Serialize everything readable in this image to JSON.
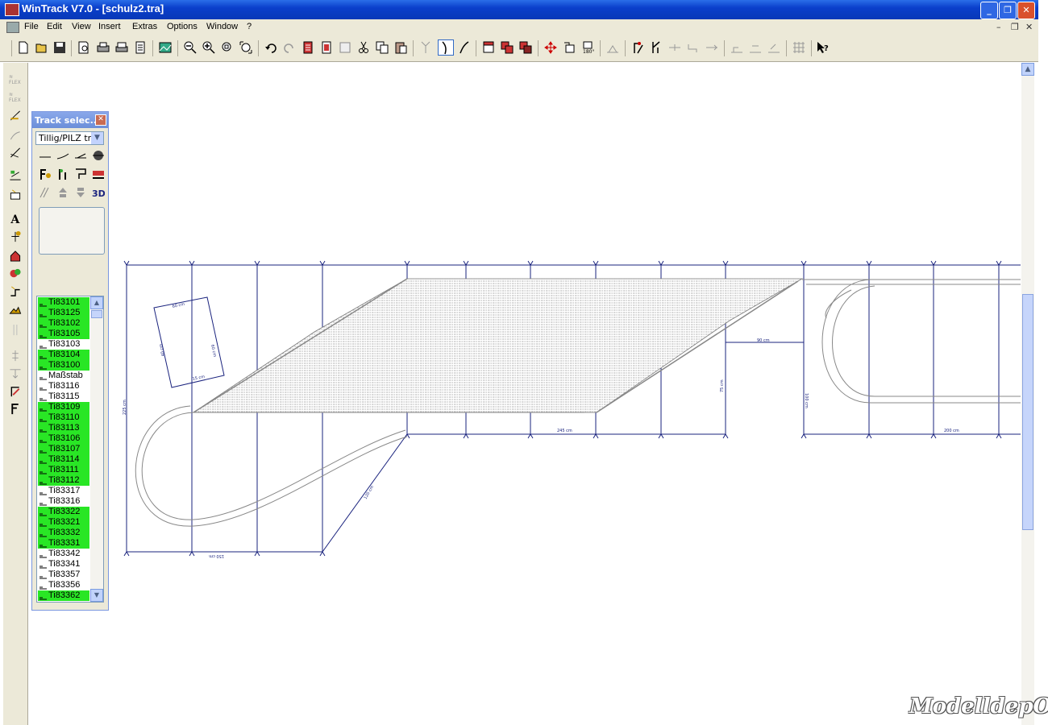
{
  "window": {
    "title": "WinTrack  V7.0 - [schulz2.tra]"
  },
  "menubar": {
    "items": [
      "File",
      "Edit",
      "View",
      "Insert",
      "Extras",
      "Options",
      "Window",
      "?"
    ]
  },
  "toolbar": {
    "icons": [
      "new-icon",
      "open-icon",
      "save-icon",
      "print-preview-icon",
      "print-icon",
      "print-setup-icon",
      "page-icon",
      "landscape-icon",
      "zoom-out-icon",
      "zoom-in-icon",
      "zoom-window-icon",
      "zoom-fit-icon",
      "undo-icon",
      "redo-icon",
      "parts-list-icon",
      "report-icon",
      "table-icon",
      "cut-icon",
      "copy-icon",
      "paste-icon",
      "switch-icon",
      "curve-icon",
      "flex-icon",
      "layer-icon",
      "layer-copy-icon",
      "layer-move-icon",
      "move-icon",
      "rotate-icon",
      "rotate-180-icon",
      "height-icon",
      "signal-icon",
      "turnout-icon",
      "line-icon",
      "connect-icon",
      "join-icon",
      "ramp-icon",
      "ramp2-icon",
      "ramp3-icon",
      "grid-icon",
      "help-icon"
    ]
  },
  "lefttoolbar": {
    "flex1": "FLEX",
    "flex2": "FLEX",
    "text_tool": "A"
  },
  "track_panel": {
    "title": "Track selec...",
    "manufacturer": "Tillig/PILZ tra",
    "label_3d": "3D",
    "items": [
      {
        "label": "Ti83101",
        "highlighted": true
      },
      {
        "label": "Ti83125",
        "highlighted": true
      },
      {
        "label": "Ti83102",
        "highlighted": true
      },
      {
        "label": "Ti83105",
        "highlighted": true
      },
      {
        "label": "Ti83103",
        "highlighted": false
      },
      {
        "label": "Ti83104",
        "highlighted": true
      },
      {
        "label": "Ti83100",
        "highlighted": true
      },
      {
        "label": "Maßstab",
        "highlighted": false
      },
      {
        "label": "Ti83116",
        "highlighted": false
      },
      {
        "label": "Ti83115",
        "highlighted": false
      },
      {
        "label": "Ti83109",
        "highlighted": true
      },
      {
        "label": "Ti83110",
        "highlighted": true
      },
      {
        "label": "Ti83113",
        "highlighted": true
      },
      {
        "label": "Ti83106",
        "highlighted": true
      },
      {
        "label": "Ti83107",
        "highlighted": true
      },
      {
        "label": "Ti83114",
        "highlighted": true
      },
      {
        "label": "Ti83111",
        "highlighted": true
      },
      {
        "label": "Ti83112",
        "highlighted": true
      },
      {
        "label": "Ti83317",
        "highlighted": false
      },
      {
        "label": "Ti83316",
        "highlighted": false
      },
      {
        "label": "Ti83322",
        "highlighted": true
      },
      {
        "label": "Ti83321",
        "highlighted": true
      },
      {
        "label": "Ti83332",
        "highlighted": true
      },
      {
        "label": "Ti83331",
        "highlighted": true
      },
      {
        "label": "Ti83342",
        "highlighted": false
      },
      {
        "label": "Ti83341",
        "highlighted": false
      },
      {
        "label": "Ti83357",
        "highlighted": false
      },
      {
        "label": "Ti83356",
        "highlighted": false
      },
      {
        "label": "Ti83362",
        "highlighted": true
      }
    ]
  },
  "drawing": {
    "dim_labels": {
      "top": "",
      "left_side": "225 cm",
      "bottom_mid": "245 cm",
      "bottom_right": "200 cm",
      "bottom_left": "150 cm",
      "diag": "120 cm",
      "inner_h": "90 cm",
      "inner_v": "75 cm",
      "right_v": "100 cm",
      "box_top": "60 cm",
      "box_right": "60 cm",
      "box_left": "40 cm",
      "box_bottom": "15 cm"
    },
    "colors": {
      "frame": "#1a237e",
      "track": "#808080",
      "text": "#1a237e"
    }
  },
  "watermark": "ModelldepO"
}
